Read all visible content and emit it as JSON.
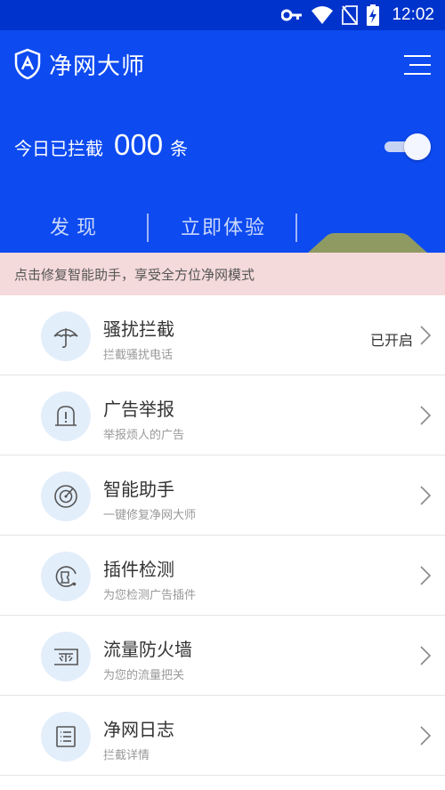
{
  "status_bar": {
    "time": "12:02",
    "icons": [
      "vpn-key-icon",
      "wifi-icon",
      "no-sim-icon",
      "battery-charging-icon"
    ]
  },
  "header": {
    "app_title": "净网大师",
    "logo_icon": "shield-logo-icon",
    "menu_icon": "menu-icon"
  },
  "summary": {
    "label": "今日已拦截",
    "count": "000",
    "unit": "条",
    "toggle_on": true
  },
  "tabs": [
    {
      "label": "发现"
    },
    {
      "label": "立即体验"
    }
  ],
  "notice": {
    "text": "点击修复智能助手，享受全方位净网模式"
  },
  "items": [
    {
      "title": "骚扰拦截",
      "subtitle": "拦截骚扰电话",
      "status": "已开启",
      "icon": "umbrella-icon"
    },
    {
      "title": "广告举报",
      "subtitle": "举报烦人的广告",
      "status": "",
      "icon": "alert-icon"
    },
    {
      "title": "智能助手",
      "subtitle": "一键修复净网大师",
      "status": "",
      "icon": "radar-icon"
    },
    {
      "title": "插件检测",
      "subtitle": "为您检测广告插件",
      "status": "",
      "icon": "plugin-scan-icon"
    },
    {
      "title": "流量防火墙",
      "subtitle": "为您的流量把关",
      "status": "",
      "icon": "firewall-icon"
    },
    {
      "title": "净网日志",
      "subtitle": "拦截详情",
      "status": "",
      "icon": "log-icon"
    }
  ],
  "colors": {
    "status_bar": "#0033cc",
    "hero": "#0d4af0",
    "notice_bg": "#f5dadb",
    "icon_bg": "#e3eefb",
    "icon_stroke": "#555555"
  }
}
